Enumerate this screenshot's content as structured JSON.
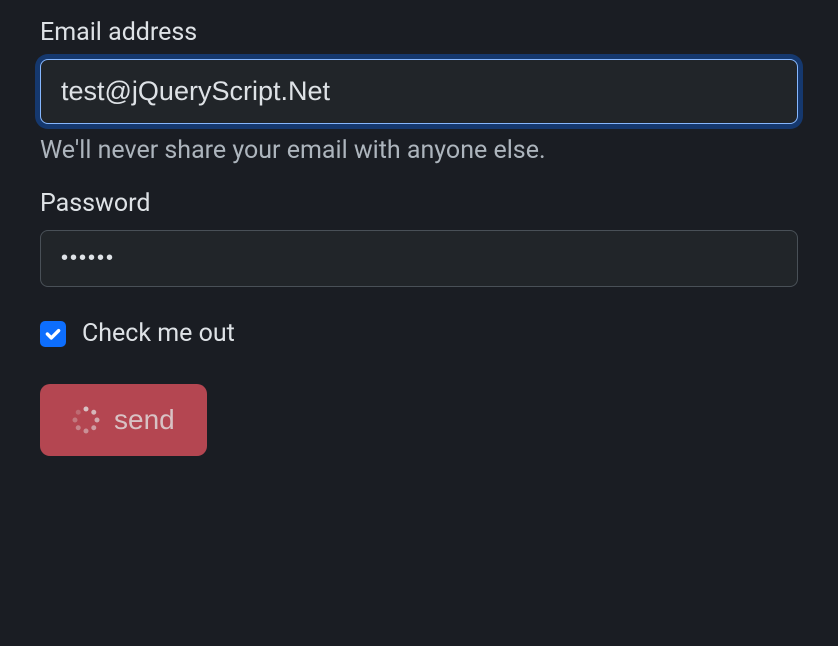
{
  "form": {
    "email": {
      "label": "Email address",
      "value": "test@jQueryScript.Net",
      "help": "We'll never share your email with anyone else."
    },
    "password": {
      "label": "Password",
      "value": "••••••"
    },
    "checkbox": {
      "label": "Check me out",
      "checked": true
    },
    "submit": {
      "label": "send"
    }
  }
}
